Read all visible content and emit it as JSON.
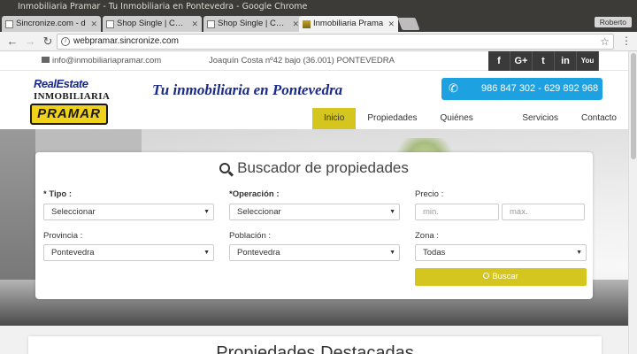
{
  "window": {
    "title": "Inmobiliaria Pramar - Tu Inmobiliaria en Pontevedra - Google Chrome",
    "profile": "Roberto"
  },
  "tabs": [
    {
      "label": "Sincronize.com - d"
    },
    {
      "label": "Shop Single | Canv"
    },
    {
      "label": "Shop Single | Canv"
    },
    {
      "label": "Inmobiliaria Prama"
    }
  ],
  "toolbar": {
    "url": "webpramar.sincronize.com"
  },
  "topbar": {
    "email": "info@inmobiliariapramar.com",
    "address": "Joaquín Costa nº42 bajo (36.001) PONTEVEDRA",
    "social": [
      "f",
      "G+",
      "t",
      "in",
      "You"
    ]
  },
  "header": {
    "logo_line1": "RealEstate",
    "logo_line2": "INMOBILIARIA",
    "logo_line3": "PRAMAR",
    "tagline": "Tu inmobiliaria en Pontevedra",
    "phone": "986 847 302 - 629 892 968"
  },
  "nav": [
    "Inicio",
    "Propiedades",
    "Quiénes somos",
    "Servicios",
    "Contacto"
  ],
  "search": {
    "title": "Buscador de propiedades",
    "tipo_label": "* Tipo :",
    "tipo_value": "Seleccionar",
    "operacion_label": "*Operación :",
    "operacion_value": "Seleccionar",
    "precio_label": "Precio :",
    "precio_min": "min.",
    "precio_max": "max.",
    "provincia_label": "Provincia :",
    "provincia_value": "Pontevedra",
    "poblacion_label": "Población :",
    "poblacion_value": "Pontevedra",
    "zona_label": "Zona :",
    "zona_value": "Todas",
    "button": "Buscar"
  },
  "section": {
    "title": "Propiedades Destacadas"
  }
}
